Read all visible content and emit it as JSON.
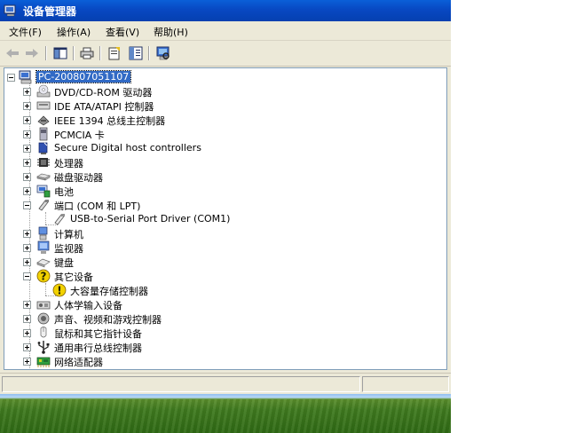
{
  "window": {
    "title": "设备管理器"
  },
  "menu": [
    "文件(F)",
    "操作(A)",
    "查看(V)",
    "帮助(H)"
  ],
  "toolbar": {
    "buttons": [
      {
        "name": "back-button",
        "icon": "arrow-left-icon"
      },
      {
        "name": "forward-button",
        "icon": "arrow-right-icon"
      },
      {
        "name": "show-hide-console-tree-button",
        "icon": "console-tree-icon"
      },
      {
        "name": "print-button",
        "icon": "printer-icon"
      },
      {
        "name": "properties-button",
        "icon": "properties-icon"
      },
      {
        "name": "help-button",
        "icon": "help-icon"
      },
      {
        "name": "scan-hardware-button",
        "icon": "scan-hardware-icon"
      }
    ]
  },
  "tree": {
    "root": "PC-200807051107",
    "items": [
      {
        "label": "DVD/CD-ROM 驱动器",
        "level": 1,
        "expanded": false,
        "icon": "cdrom-icon"
      },
      {
        "label": "IDE ATA/ATAPI 控制器",
        "level": 1,
        "expanded": false,
        "icon": "ide-controller-icon"
      },
      {
        "label": "IEEE 1394 总线主控制器",
        "level": 1,
        "expanded": false,
        "icon": "ieee1394-icon"
      },
      {
        "label": "PCMCIA 卡",
        "level": 1,
        "expanded": false,
        "icon": "pcmcia-icon"
      },
      {
        "label": "Secure Digital host controllers",
        "level": 1,
        "expanded": false,
        "icon": "sd-controller-icon"
      },
      {
        "label": "处理器",
        "level": 1,
        "expanded": false,
        "icon": "processor-icon"
      },
      {
        "label": "磁盘驱动器",
        "level": 1,
        "expanded": false,
        "icon": "disk-drive-icon"
      },
      {
        "label": "电池",
        "level": 1,
        "expanded": false,
        "icon": "battery-icon"
      },
      {
        "label": "端口 (COM 和 LPT)",
        "level": 1,
        "expanded": true,
        "icon": "port-icon"
      },
      {
        "label": "USB-to-Serial Port Driver (COM1)",
        "level": 2,
        "icon": "serial-port-icon"
      },
      {
        "label": "计算机",
        "level": 1,
        "expanded": false,
        "icon": "computer-icon"
      },
      {
        "label": "监视器",
        "level": 1,
        "expanded": false,
        "icon": "monitor-icon"
      },
      {
        "label": "键盘",
        "level": 1,
        "expanded": false,
        "icon": "keyboard-icon"
      },
      {
        "label": "其它设备",
        "level": 1,
        "expanded": true,
        "icon": "unknown-device-icon"
      },
      {
        "label": "大容量存储控制器",
        "level": 2,
        "icon": "warning-device-icon"
      },
      {
        "label": "人体学输入设备",
        "level": 1,
        "expanded": false,
        "icon": "hid-icon"
      },
      {
        "label": "声音、视频和游戏控制器",
        "level": 1,
        "expanded": false,
        "icon": "sound-icon"
      },
      {
        "label": "鼠标和其它指针设备",
        "level": 1,
        "expanded": false,
        "icon": "mouse-icon"
      },
      {
        "label": "通用串行总线控制器",
        "level": 1,
        "expanded": false,
        "icon": "usb-icon"
      },
      {
        "label": "网络适配器",
        "level": 1,
        "expanded": false,
        "icon": "network-adapter-icon"
      }
    ]
  },
  "colors": {
    "titlebar": "#0a5fd8",
    "selection": "#316ac5",
    "chrome": "#ece9d8",
    "warning": "#f2d200"
  }
}
